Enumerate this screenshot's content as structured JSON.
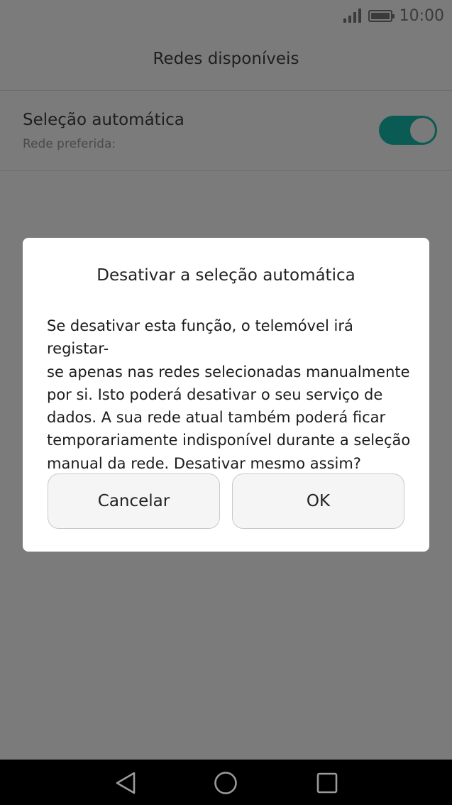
{
  "status_bar": {
    "time": "10:00",
    "icons": [
      "signal-icon",
      "battery-icon"
    ]
  },
  "app_bar": {
    "title": "Redes disponíveis"
  },
  "settings": {
    "auto_select": {
      "title": "Seleção automática",
      "subtitle": "Rede preferida:",
      "toggle_on": true,
      "toggle_color": "#0b5b55"
    }
  },
  "dialog": {
    "title": "Desativar a seleção automática",
    "message_lines": [
      "Se desativar esta função, o telemóvel irá registar-",
      "se apenas nas redes selecionadas manualmente",
      "por si. Isto poderá desativar o seu serviço de",
      "dados. A sua rede atual também poderá ficar",
      "temporariamente indisponível durante a seleção",
      "manual da rede. Desativar mesmo assim?"
    ],
    "cancel_label": "Cancelar",
    "ok_label": "OK"
  },
  "nav_bar": {
    "buttons": [
      "back-icon",
      "home-icon",
      "recent-apps-icon"
    ]
  }
}
